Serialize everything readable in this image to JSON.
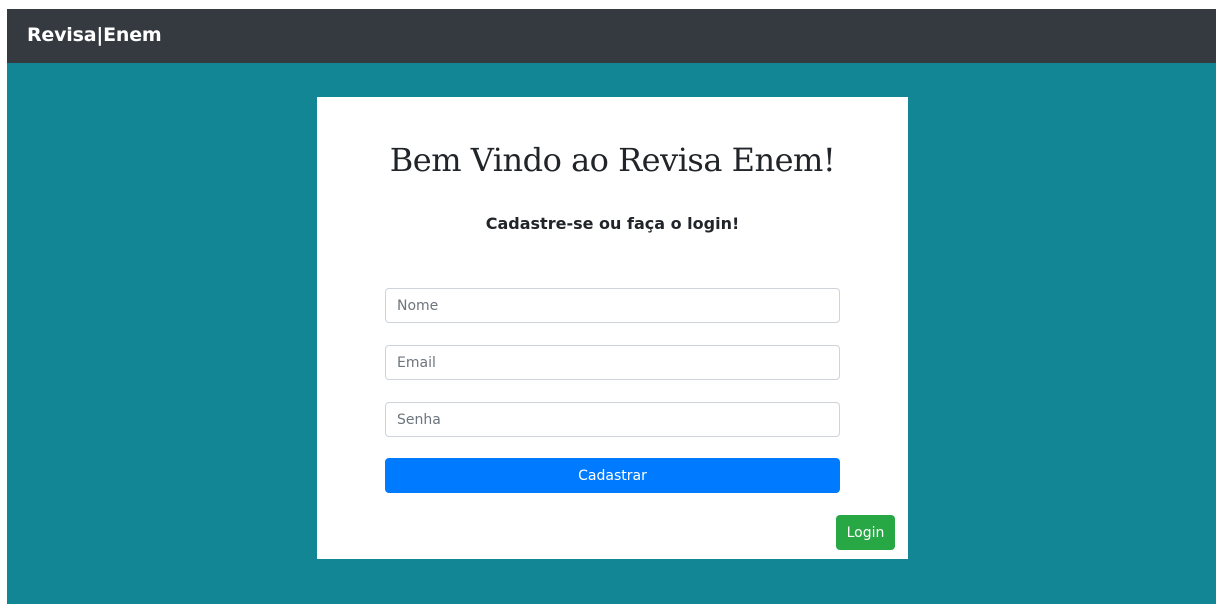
{
  "navbar": {
    "brand": "Revisa|Enem"
  },
  "card": {
    "title": "Bem Vindo ao Revisa Enem!",
    "subtitle": "Cadastre-se ou faça o login!"
  },
  "form": {
    "nome": {
      "placeholder": "Nome",
      "value": ""
    },
    "email": {
      "placeholder": "Email",
      "value": ""
    },
    "senha": {
      "placeholder": "Senha",
      "value": ""
    },
    "submit_label": "Cadastrar",
    "login_label": "Login"
  },
  "colors": {
    "navbar_bg": "#343a40",
    "page_bg": "#138695",
    "primary": "#007bff",
    "success": "#28a745"
  }
}
